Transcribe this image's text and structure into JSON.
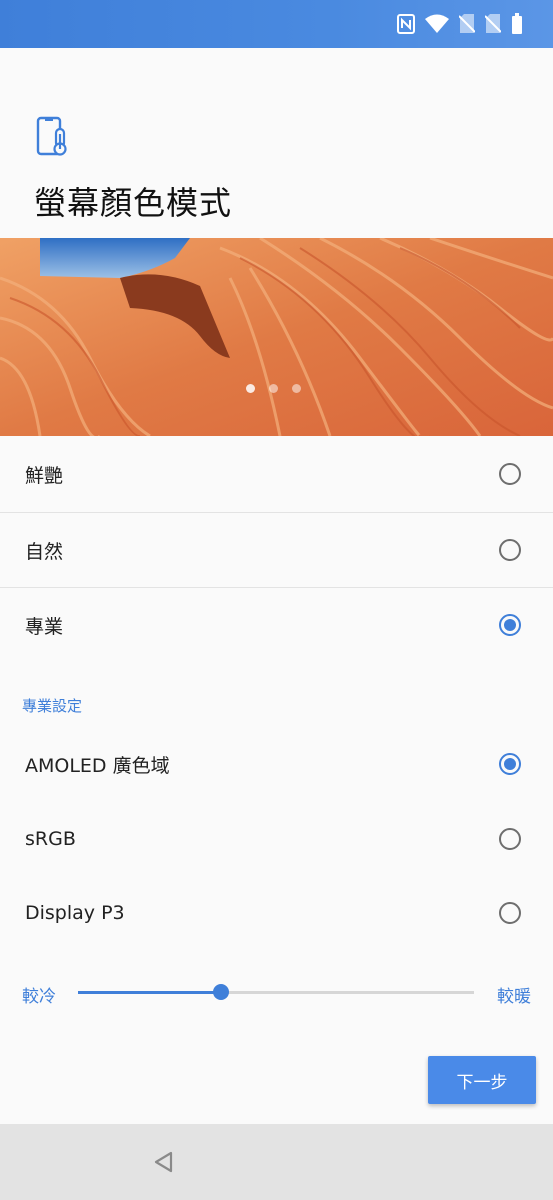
{
  "page": {
    "title": "螢幕顏色模式",
    "accent": "#3f7fd9"
  },
  "status_icons": [
    "nfc-icon",
    "wifi-icon",
    "no-sim-icon",
    "no-sim-icon",
    "battery-icon"
  ],
  "modes": [
    {
      "label": "鮮艷",
      "selected": false
    },
    {
      "label": "自然",
      "selected": false
    },
    {
      "label": "專業",
      "selected": true
    }
  ],
  "pro_settings": {
    "header": "專業設定",
    "options": [
      {
        "label": "AMOLED 廣色域",
        "selected": true
      },
      {
        "label": "sRGB",
        "selected": false
      },
      {
        "label": "Display P3",
        "selected": false
      }
    ]
  },
  "temperature": {
    "left_label": "較冷",
    "right_label": "較暖",
    "value": 0.36
  },
  "carousel": {
    "count": 3,
    "active": 0
  },
  "next_button": "下一步"
}
